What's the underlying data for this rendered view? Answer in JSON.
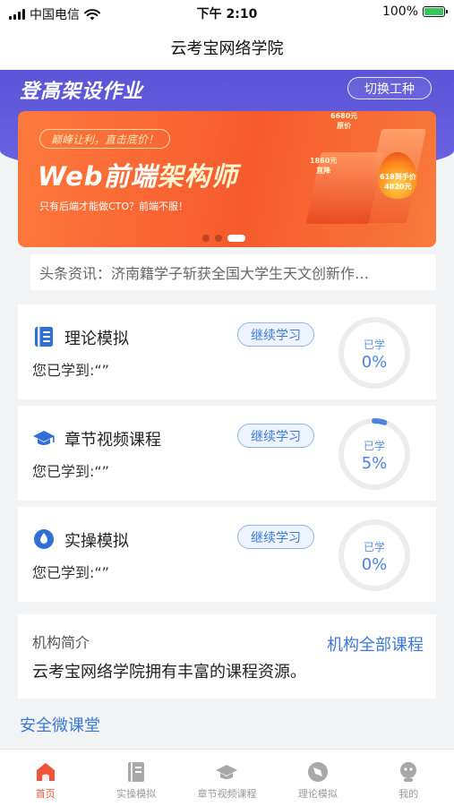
{
  "status_bar": {
    "carrier": "中国电信",
    "time": "下午 2:10",
    "battery": "100%"
  },
  "nav": {
    "title": "云考宝网络学院"
  },
  "header": {
    "title": "登高架设作业",
    "switch_label": "切换工种"
  },
  "banner": {
    "pill": "巅峰让利，直击底价！",
    "title_part1": "Web前端",
    "title_part2": "架构师",
    "subtitle": "只有后端才能做CTO？前端不服！",
    "price_1_amount": "6680元",
    "price_1_note": "原价",
    "price_2_amount": "1860元",
    "price_2_note": "直降",
    "price_3_note": "618到手价",
    "price_3_amount": "4820元",
    "slide_count": 3,
    "active_slide": 3
  },
  "news": {
    "text": "头条资讯：济南籍学子斩获全国大学生天文创新作…"
  },
  "courses": [
    {
      "title": "理论模拟",
      "button": "继续学习",
      "progress_text": "您已学到:“”",
      "ring_label": "已学",
      "ring_value": "0%",
      "percent": 0,
      "icon": "book-icon"
    },
    {
      "title": "章节视频课程",
      "button": "继续学习",
      "progress_text": "您已学到:“”",
      "ring_label": "已学",
      "ring_value": "5%",
      "percent": 5,
      "icon": "graduation-cap-icon"
    },
    {
      "title": "实操模拟",
      "button": "继续学习",
      "progress_text": "您已学到:“”",
      "ring_label": "已学",
      "ring_value": "0%",
      "percent": 0,
      "icon": "drop-icon"
    }
  ],
  "org": {
    "title": "机构简介",
    "link": "机构全部课程",
    "desc": "云考宝网络学院拥有丰富的课程资源。"
  },
  "safety_link": "安全微课堂",
  "tabs": [
    {
      "label": "首页",
      "icon": "home-icon",
      "active": true
    },
    {
      "label": "实操模拟",
      "icon": "book-icon",
      "active": false
    },
    {
      "label": "章节视频课程",
      "icon": "graduation-cap-icon",
      "active": false
    },
    {
      "label": "理论模拟",
      "icon": "compass-icon",
      "active": false
    },
    {
      "label": "我的",
      "icon": "user-icon",
      "active": false
    }
  ],
  "colors": {
    "header_purple": "#5b54d6",
    "accent_blue": "#3a78d8",
    "tab_active": "#f0553a",
    "banner_orange": "#f65a2e"
  }
}
